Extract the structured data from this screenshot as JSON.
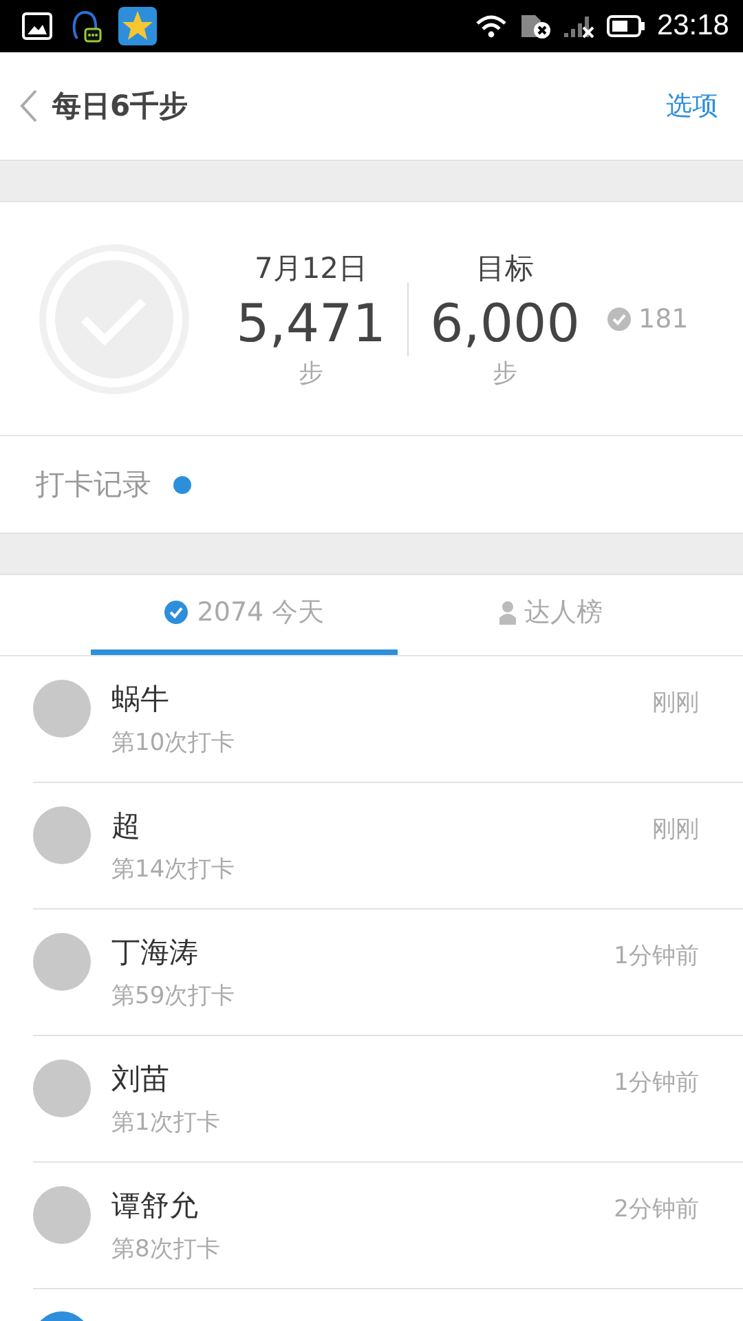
{
  "status_bar": {
    "time": "23:18"
  },
  "header": {
    "title": "每日6千步",
    "action": "选项"
  },
  "summary": {
    "date": "7月12日",
    "steps": "5,471",
    "steps_unit": "步",
    "goal_label": "目标",
    "goal": "6,000",
    "goal_unit": "步",
    "count": "181"
  },
  "checkin_record": {
    "label": "打卡记录",
    "unread": true
  },
  "tabs": [
    {
      "count": "2074",
      "label": "今天",
      "kind": "check",
      "selected": true
    },
    {
      "label": "达人榜",
      "kind": "person",
      "selected": false
    }
  ],
  "entries": [
    {
      "name": "蜗牛",
      "detail": "第10次打卡",
      "time": "刚刚"
    },
    {
      "name": "超",
      "detail": "第14次打卡",
      "time": "刚刚"
    },
    {
      "name": "丁海涛",
      "detail": "第59次打卡",
      "time": "1分钟前"
    },
    {
      "name": "刘苗",
      "detail": "第1次打卡",
      "time": "1分钟前"
    },
    {
      "name": "谭舒允",
      "detail": "第8次打卡",
      "time": "2分钟前"
    }
  ]
}
